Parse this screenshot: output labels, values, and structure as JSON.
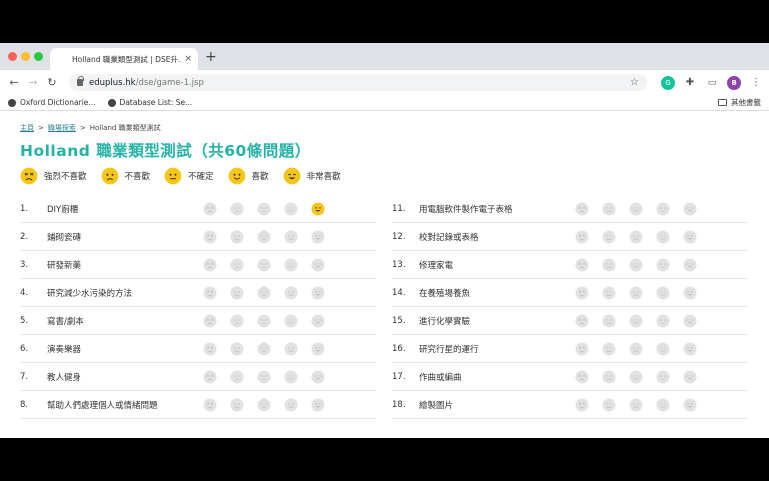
{
  "browser": {
    "tab_title": "Holland 職業類型測試 | DSE升...",
    "tab_close": "×",
    "new_tab": "+",
    "url_host": "eduplus.hk",
    "url_path": "/dse/game-1.jsp",
    "avatar_letter": "B",
    "grammarly_letter": "G",
    "bookmarks": [
      {
        "label": "Oxford Dictionarie..."
      },
      {
        "label": "Database List: Se..."
      }
    ],
    "other_bookmarks": "其他書籤"
  },
  "breadcrumb": {
    "home": "主頁",
    "career": "職場探索",
    "current": "Holland 職業類型測試",
    "sep": ">"
  },
  "page_title": "Holland 職業類型測試（共60條問題）",
  "legend": [
    {
      "label": "強烈不喜歡",
      "mood": "angry",
      "color": "#f5c518"
    },
    {
      "label": "不喜歡",
      "mood": "sad",
      "color": "#f5c518"
    },
    {
      "label": "不確定",
      "mood": "neutral",
      "color": "#f5c518"
    },
    {
      "label": "喜歡",
      "mood": "smile",
      "color": "#f5c518"
    },
    {
      "label": "非常喜歡",
      "mood": "grin",
      "color": "#f5c518"
    }
  ],
  "questions_left": [
    {
      "num": "1.",
      "text": "DIY廚櫃",
      "selected": 4
    },
    {
      "num": "2.",
      "text": "鋪砌瓷磚",
      "selected": -1
    },
    {
      "num": "3.",
      "text": "研發新藥",
      "selected": -1
    },
    {
      "num": "4.",
      "text": "研究減少水污染的方法",
      "selected": -1
    },
    {
      "num": "5.",
      "text": "寫書/劇本",
      "selected": -1
    },
    {
      "num": "6.",
      "text": "演奏樂器",
      "selected": -1
    },
    {
      "num": "7.",
      "text": "教人健身",
      "selected": -1
    },
    {
      "num": "8.",
      "text": "幫助人們處理個人或情緒問題",
      "selected": -1
    }
  ],
  "questions_right": [
    {
      "num": "11.",
      "text": "用電腦軟件製作電子表格",
      "selected": -1
    },
    {
      "num": "12.",
      "text": "校對記錄或表格",
      "selected": -1
    },
    {
      "num": "13.",
      "text": "修理家電",
      "selected": -1
    },
    {
      "num": "14.",
      "text": "在養殖場養魚",
      "selected": -1
    },
    {
      "num": "15.",
      "text": "進行化學實驗",
      "selected": -1
    },
    {
      "num": "16.",
      "text": "研究行星的運行",
      "selected": -1
    },
    {
      "num": "17.",
      "text": "作曲或編曲",
      "selected": -1
    },
    {
      "num": "18.",
      "text": "繪製圖片",
      "selected": -1
    }
  ],
  "colors": {
    "title": "#26b3a6",
    "face_active": "#f5c518",
    "face_inactive": "#e2e2e2"
  }
}
